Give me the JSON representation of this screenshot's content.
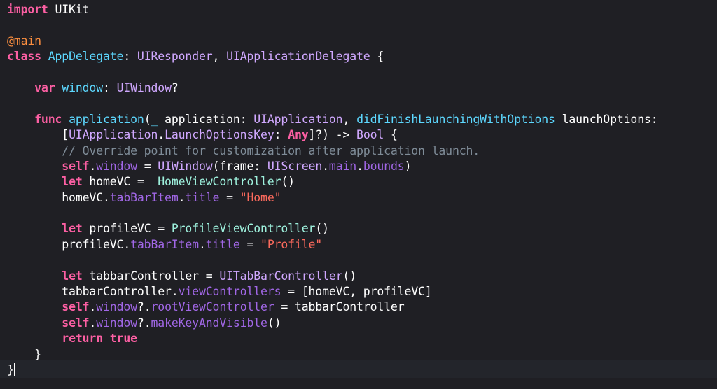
{
  "editor": {
    "language": "swift",
    "theme_colors": {
      "background": "#1f1f24",
      "keyword": "#fc5fa3",
      "plain": "#ffffff",
      "type": "#d0a8ff",
      "declaration": "#5dd8ff",
      "property": "#a167e6",
      "string": "#fc6a5d",
      "comment": "#7f8c98",
      "attribute": "#fd8f3f",
      "project_class": "#9ef1dd"
    },
    "lines": [
      [
        {
          "t": "kw",
          "s": "import"
        },
        {
          "t": "pl",
          "s": " UIKit"
        }
      ],
      [],
      [
        {
          "t": "attr",
          "s": "@main"
        }
      ],
      [
        {
          "t": "kw",
          "s": "class"
        },
        {
          "t": "pl",
          "s": " "
        },
        {
          "t": "decl",
          "s": "AppDelegate"
        },
        {
          "t": "pl",
          "s": ": "
        },
        {
          "t": "ty",
          "s": "UIResponder"
        },
        {
          "t": "pl",
          "s": ", "
        },
        {
          "t": "ty",
          "s": "UIApplicationDelegate"
        },
        {
          "t": "pl",
          "s": " {"
        }
      ],
      [],
      [
        {
          "t": "pl",
          "s": "    "
        },
        {
          "t": "kw",
          "s": "var"
        },
        {
          "t": "pl",
          "s": " "
        },
        {
          "t": "decl",
          "s": "window"
        },
        {
          "t": "pl",
          "s": ": "
        },
        {
          "t": "ty",
          "s": "UIWindow"
        },
        {
          "t": "pl",
          "s": "?"
        }
      ],
      [],
      [
        {
          "t": "pl",
          "s": "    "
        },
        {
          "t": "kw",
          "s": "func"
        },
        {
          "t": "pl",
          "s": " "
        },
        {
          "t": "decl",
          "s": "application"
        },
        {
          "t": "pl",
          "s": "("
        },
        {
          "t": "decl",
          "s": "_"
        },
        {
          "t": "pl",
          "s": " application: "
        },
        {
          "t": "ty",
          "s": "UIApplication"
        },
        {
          "t": "pl",
          "s": ", "
        },
        {
          "t": "decl",
          "s": "didFinishLaunchingWithOptions"
        },
        {
          "t": "pl",
          "s": " launchOptions:"
        }
      ],
      [
        {
          "t": "pl",
          "s": "        ["
        },
        {
          "t": "ty",
          "s": "UIApplication"
        },
        {
          "t": "pl",
          "s": "."
        },
        {
          "t": "ty",
          "s": "LaunchOptionsKey"
        },
        {
          "t": "pl",
          "s": ": "
        },
        {
          "t": "kw",
          "s": "Any"
        },
        {
          "t": "pl",
          "s": "]?) -> "
        },
        {
          "t": "ty",
          "s": "Bool"
        },
        {
          "t": "pl",
          "s": " {"
        }
      ],
      [
        {
          "t": "pl",
          "s": "        "
        },
        {
          "t": "cm",
          "s": "// Override point for customization after application launch."
        }
      ],
      [
        {
          "t": "pl",
          "s": "        "
        },
        {
          "t": "kw",
          "s": "self"
        },
        {
          "t": "pl",
          "s": "."
        },
        {
          "t": "prop",
          "s": "window"
        },
        {
          "t": "pl",
          "s": " = "
        },
        {
          "t": "ty",
          "s": "UIWindow"
        },
        {
          "t": "pl",
          "s": "(frame: "
        },
        {
          "t": "ty",
          "s": "UIScreen"
        },
        {
          "t": "pl",
          "s": "."
        },
        {
          "t": "prop",
          "s": "main"
        },
        {
          "t": "pl",
          "s": "."
        },
        {
          "t": "prop",
          "s": "bounds"
        },
        {
          "t": "pl",
          "s": ")"
        }
      ],
      [
        {
          "t": "pl",
          "s": "        "
        },
        {
          "t": "kw",
          "s": "let"
        },
        {
          "t": "pl",
          "s": " homeVC =  "
        },
        {
          "t": "cls",
          "s": "HomeViewController"
        },
        {
          "t": "pl",
          "s": "()"
        }
      ],
      [
        {
          "t": "pl",
          "s": "        homeVC."
        },
        {
          "t": "prop",
          "s": "tabBarItem"
        },
        {
          "t": "pl",
          "s": "."
        },
        {
          "t": "prop",
          "s": "title"
        },
        {
          "t": "pl",
          "s": " = "
        },
        {
          "t": "str",
          "s": "\"Home\""
        }
      ],
      [],
      [
        {
          "t": "pl",
          "s": "        "
        },
        {
          "t": "kw",
          "s": "let"
        },
        {
          "t": "pl",
          "s": " profileVC = "
        },
        {
          "t": "cls",
          "s": "ProfileViewController"
        },
        {
          "t": "pl",
          "s": "()"
        }
      ],
      [
        {
          "t": "pl",
          "s": "        profileVC."
        },
        {
          "t": "prop",
          "s": "tabBarItem"
        },
        {
          "t": "pl",
          "s": "."
        },
        {
          "t": "prop",
          "s": "title"
        },
        {
          "t": "pl",
          "s": " = "
        },
        {
          "t": "str",
          "s": "\"Profile\""
        }
      ],
      [],
      [
        {
          "t": "pl",
          "s": "        "
        },
        {
          "t": "kw",
          "s": "let"
        },
        {
          "t": "pl",
          "s": " tabbarController = "
        },
        {
          "t": "ty",
          "s": "UITabBarController"
        },
        {
          "t": "pl",
          "s": "()"
        }
      ],
      [
        {
          "t": "pl",
          "s": "        tabbarController."
        },
        {
          "t": "prop",
          "s": "viewControllers"
        },
        {
          "t": "pl",
          "s": " = [homeVC, profileVC]"
        }
      ],
      [
        {
          "t": "pl",
          "s": "        "
        },
        {
          "t": "kw",
          "s": "self"
        },
        {
          "t": "pl",
          "s": "."
        },
        {
          "t": "prop",
          "s": "window"
        },
        {
          "t": "pl",
          "s": "?."
        },
        {
          "t": "prop",
          "s": "rootViewController"
        },
        {
          "t": "pl",
          "s": " = tabbarController"
        }
      ],
      [
        {
          "t": "pl",
          "s": "        "
        },
        {
          "t": "kw",
          "s": "self"
        },
        {
          "t": "pl",
          "s": "."
        },
        {
          "t": "prop",
          "s": "window"
        },
        {
          "t": "pl",
          "s": "?."
        },
        {
          "t": "prop",
          "s": "makeKeyAndVisible"
        },
        {
          "t": "pl",
          "s": "()"
        }
      ],
      [
        {
          "t": "pl",
          "s": "        "
        },
        {
          "t": "kw",
          "s": "return"
        },
        {
          "t": "pl",
          "s": " "
        },
        {
          "t": "kw",
          "s": "true"
        }
      ],
      [
        {
          "t": "pl",
          "s": "    }"
        }
      ],
      [
        {
          "t": "pl",
          "s": "}"
        }
      ]
    ],
    "cursor": {
      "line": 23
    }
  }
}
